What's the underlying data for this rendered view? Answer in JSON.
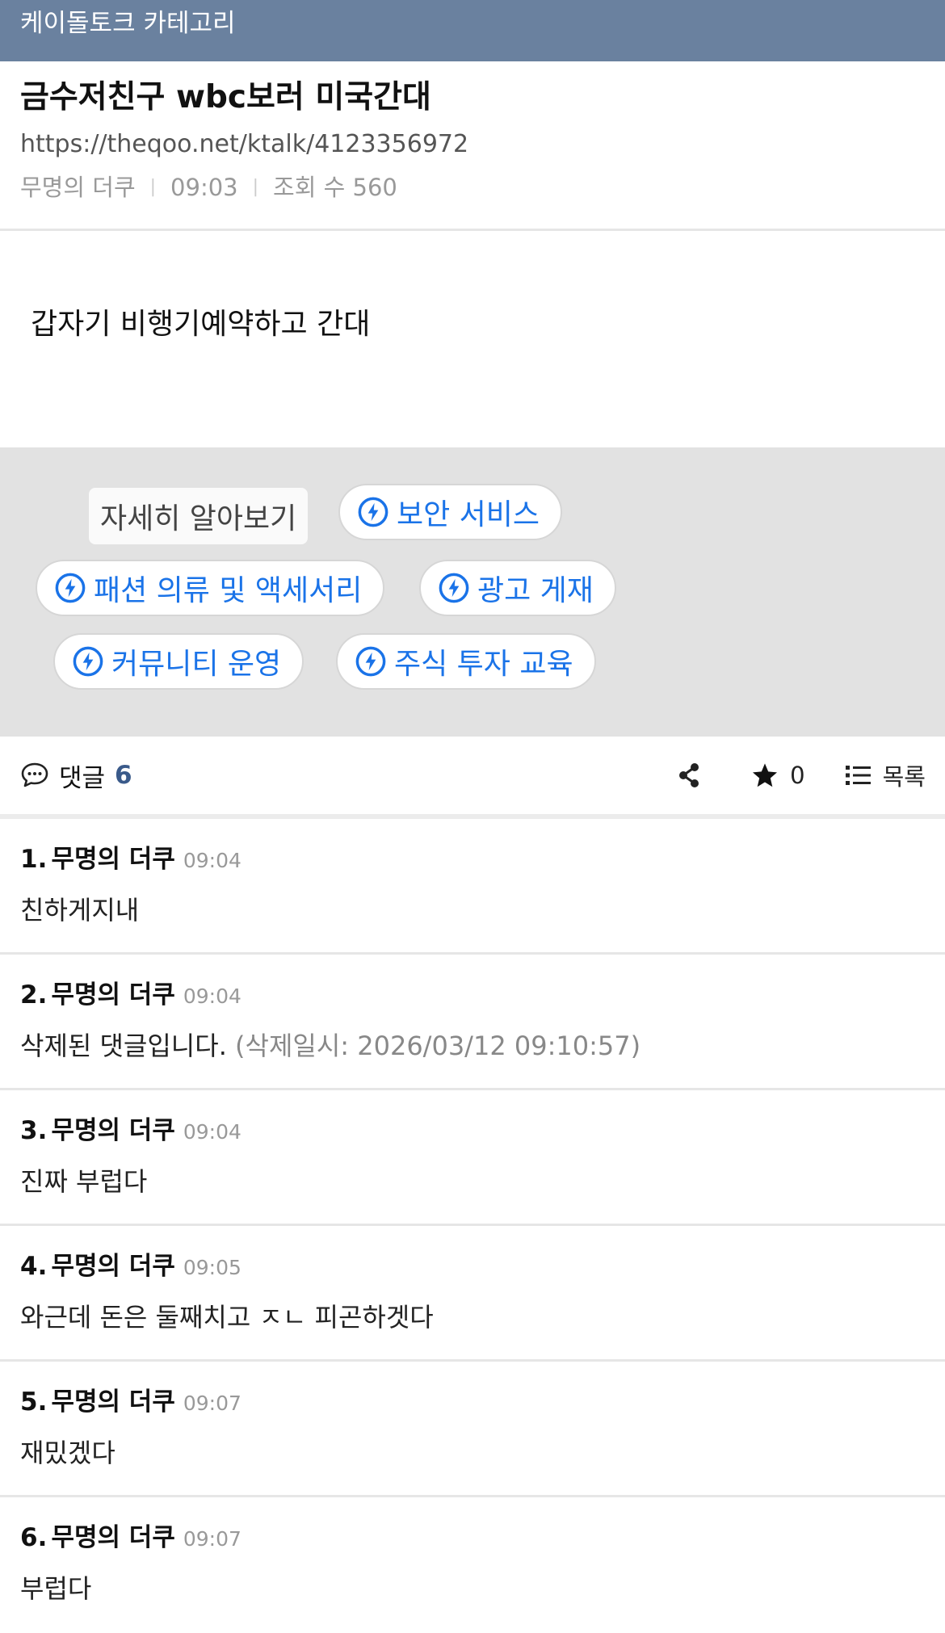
{
  "topbar": {
    "title": "케이돌토크 카테고리"
  },
  "post": {
    "title": "금수저친구 wbc보러 미국간대",
    "url": "https://theqoo.net/ktalk/4123356972",
    "author": "무명의 더쿠",
    "time": "09:03",
    "views": "조회 수 560",
    "body": "갑자기 비행기예약하고 간대"
  },
  "ad": {
    "learn_more": "자세히 알아보기",
    "chips": [
      "보안 서비스",
      "패션 의류 및 액세서리",
      "광고 게재",
      "커뮤니티 운영",
      "주식 투자 교육"
    ],
    "accent": "#1a73e8"
  },
  "toolbar": {
    "comments_label": "댓글",
    "comments_count": "6",
    "star_count": "0",
    "list_label": "목록"
  },
  "comments": [
    {
      "index": "1.",
      "author": "무명의 더쿠",
      "time": "09:04",
      "text": "친하게지내"
    },
    {
      "index": "2.",
      "author": "무명의 더쿠",
      "time": "09:04",
      "text": "삭제된 댓글입니다.",
      "deleted_note": "(삭제일시: 2026/03/12 09:10:57)"
    },
    {
      "index": "3.",
      "author": "무명의 더쿠",
      "time": "09:04",
      "text": "진짜 부럽다"
    },
    {
      "index": "4.",
      "author": "무명의 더쿠",
      "time": "09:05",
      "text": "와근데 돈은 둘째치고 ㅈㄴ 피곤하겟다"
    },
    {
      "index": "5.",
      "author": "무명의 더쿠",
      "time": "09:07",
      "text": "재밌겠다"
    },
    {
      "index": "6.",
      "author": "무명의 더쿠",
      "time": "09:07",
      "text": "부럽다"
    }
  ]
}
